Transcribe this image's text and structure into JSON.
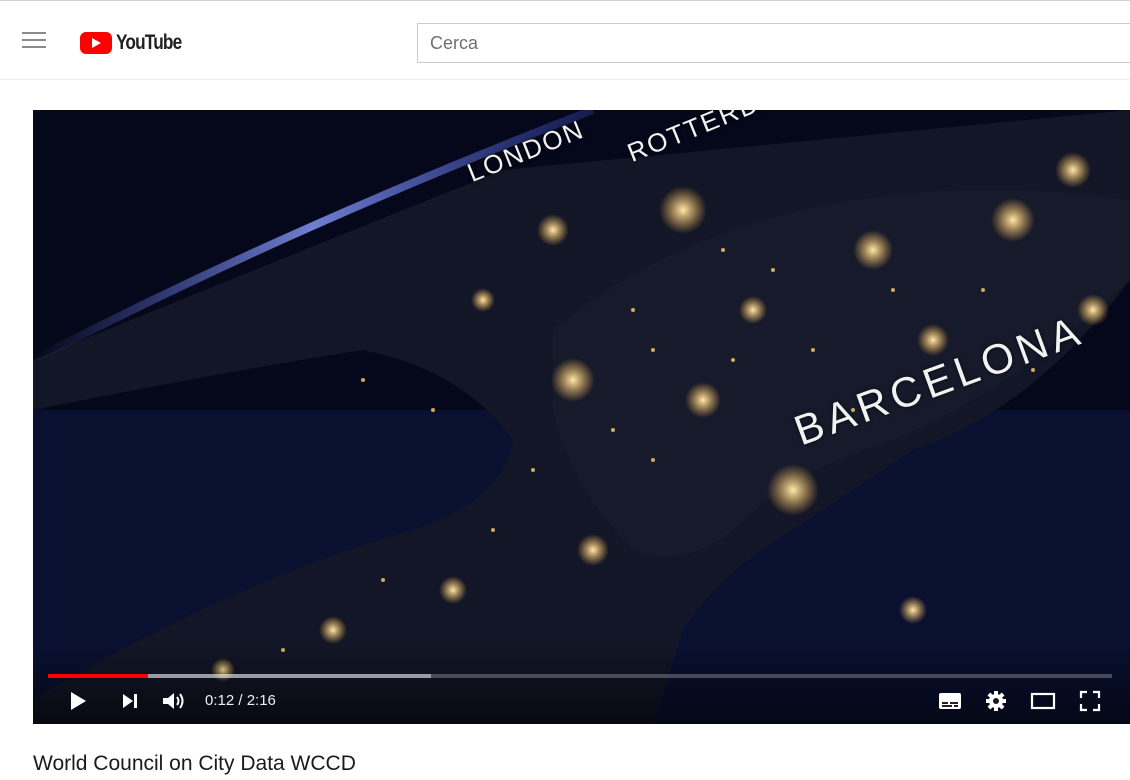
{
  "header": {
    "menu_icon": "hamburger-menu-icon",
    "logo_text": "YouTube",
    "logo_icon": "youtube-play-icon",
    "brand_color": "#ff0000",
    "search_placeholder": "Cerca"
  },
  "video": {
    "city_labels": [
      "LONDON",
      "ROTTERDAM",
      "BARCELONA"
    ],
    "time_display": "0:12 / 2:16",
    "progress_played": 0.094,
    "progress_loaded": 0.36,
    "progress_color": "#ff0000",
    "controls": {
      "play_icon": "play-icon",
      "next_icon": "next-icon",
      "volume_icon": "volume-icon",
      "subtitles_icon": "subtitles-icon",
      "settings_icon": "gear-icon",
      "theater_icon": "theater-mode-icon",
      "fullscreen_icon": "fullscreen-icon"
    }
  },
  "title": "World Council on City Data WCCD"
}
